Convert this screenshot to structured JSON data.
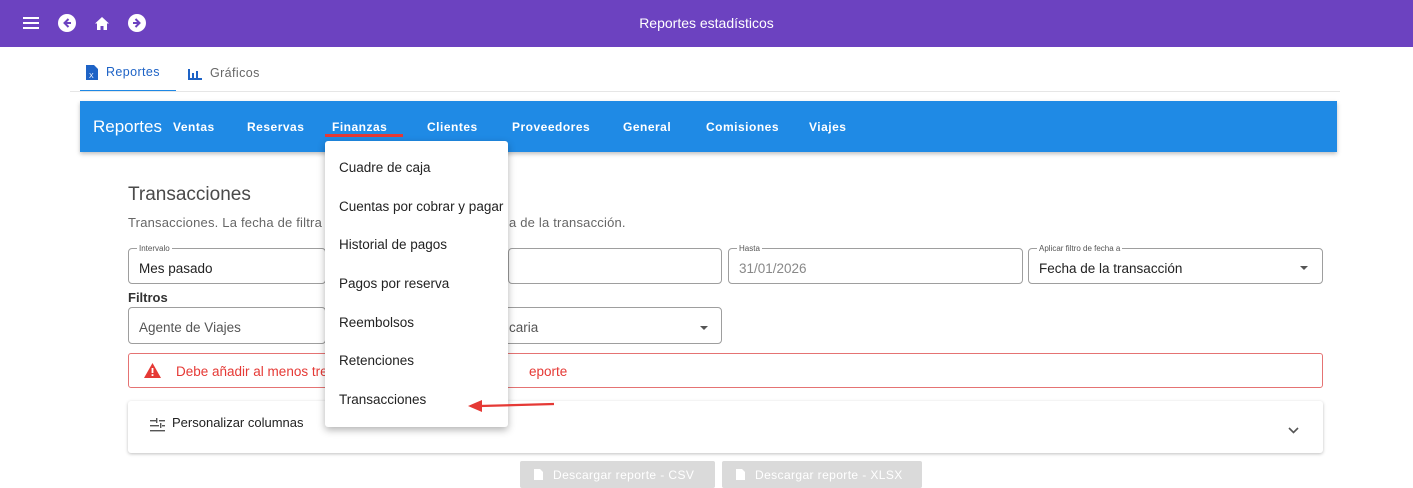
{
  "topbar": {
    "title": "Reportes estadísticos",
    "icons": [
      "menu-icon",
      "back-icon",
      "home-icon",
      "forward-icon"
    ],
    "color": "#6c42c0"
  },
  "tabs": [
    {
      "label": "Reportes",
      "icon": "excel-file-icon",
      "active": true
    },
    {
      "label": "Gráficos",
      "icon": "bar-chart-icon",
      "active": false
    }
  ],
  "navbar": {
    "brand": "Reportes",
    "color": "#1f8ae5",
    "items": [
      "Ventas",
      "Reservas",
      "Finanzas",
      "Clientes",
      "Proveedores",
      "General",
      "Comisiones",
      "Viajes"
    ],
    "active_item": "Finanzas"
  },
  "menu": {
    "items": [
      "Cuadre de caja",
      "Cuentas por cobrar y pagar",
      "Historial de pagos",
      "Pagos por reserva",
      "Reembolsos",
      "Retenciones",
      "Transacciones"
    ]
  },
  "main": {
    "title": "Transacciones",
    "desc_left": "Transacciones. La fecha de filtra",
    "desc_right": "a de la transacción.",
    "intervalo": {
      "label": "Intervalo",
      "value": "Mes pasado"
    },
    "hasta": {
      "label": "Hasta",
      "value": "31/01/2026"
    },
    "aplicar": {
      "label": "Aplicar filtro de fecha a",
      "value": "Fecha de la transacción"
    },
    "filtros_label": "Filtros",
    "agente": {
      "placeholder": "Agente de Viajes"
    },
    "cuenta": {
      "partial": "caria"
    },
    "alert": {
      "left": "Debe añadir al menos tres",
      "right": "eporte"
    },
    "personalizar": "Personalizar columnas",
    "btn_csv": "Descargar reporte - CSV",
    "btn_xlsx": "Descargar reporte - XLSX"
  }
}
